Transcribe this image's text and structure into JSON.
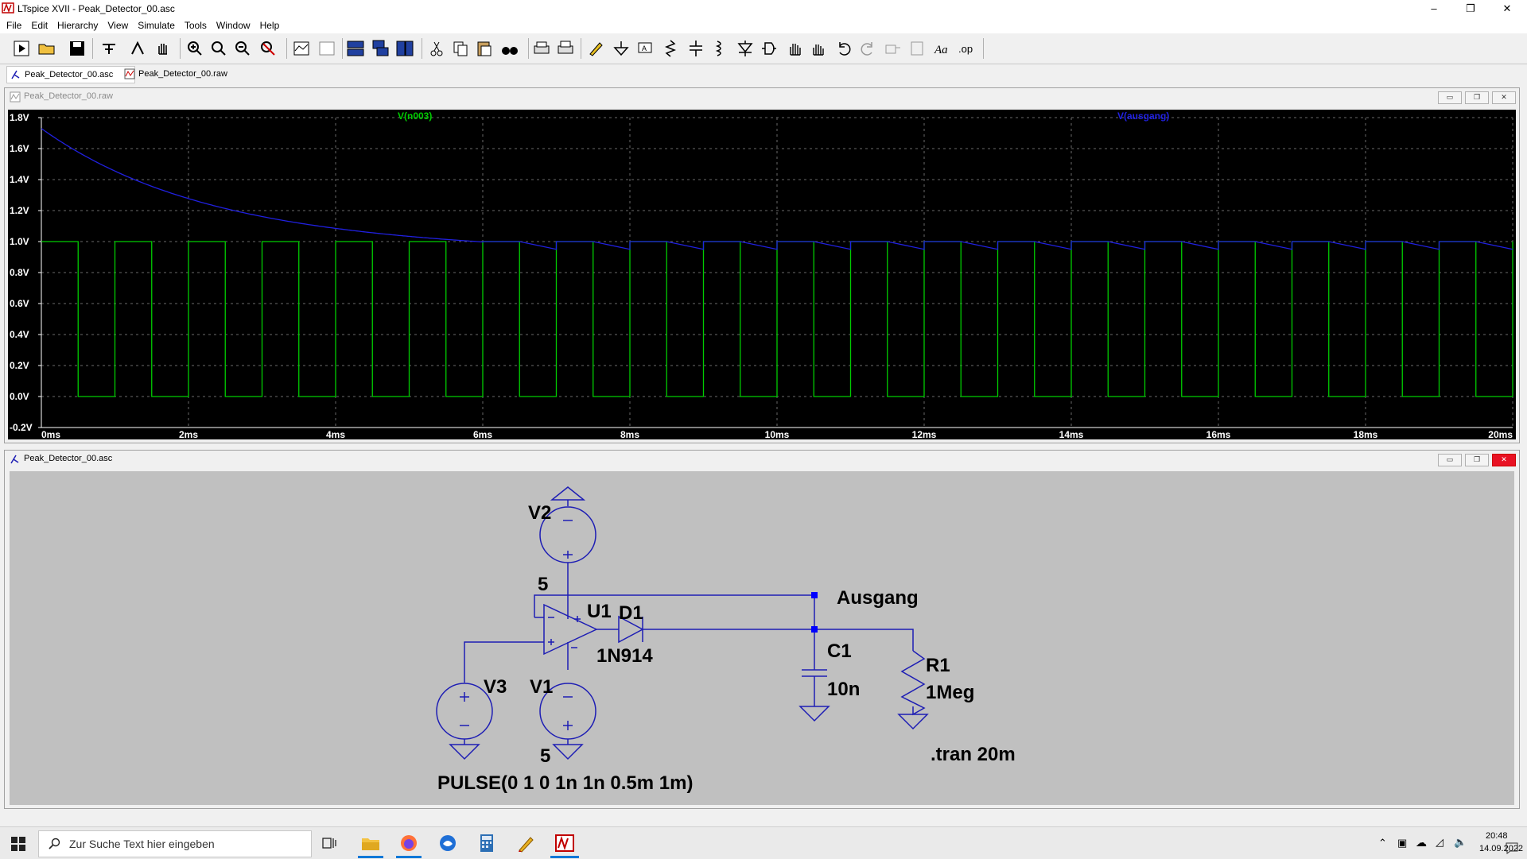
{
  "window": {
    "title": "LTspice XVII - Peak_Detector_00.asc",
    "min": "–",
    "restore": "❐",
    "close": "✕"
  },
  "menu": [
    "File",
    "Edit",
    "Hierarchy",
    "View",
    "Simulate",
    "Tools",
    "Window",
    "Help"
  ],
  "tabs": [
    {
      "label": "Peak_Detector_00.asc",
      "icon": "schematic-icon"
    },
    {
      "label": "Peak_Detector_00.raw",
      "icon": "waveform-icon"
    }
  ],
  "plot_window": {
    "title": "Peak_Detector_00.raw",
    "buttons": [
      "▭",
      "❐",
      "✕"
    ]
  },
  "schematic_window": {
    "title": "Peak_Detector_00.asc",
    "buttons": [
      "▭",
      "❐",
      "✕"
    ]
  },
  "chart_data": {
    "type": "line",
    "background": "#000000",
    "grid": true,
    "xunit": "ms",
    "xlim": [
      0,
      20
    ],
    "ylim": [
      -0.2,
      1.8
    ],
    "xticks": [
      "0ms",
      "2ms",
      "4ms",
      "6ms",
      "8ms",
      "10ms",
      "12ms",
      "14ms",
      "16ms",
      "18ms",
      "20ms"
    ],
    "yticks": [
      "1.8V",
      "1.6V",
      "1.4V",
      "1.2V",
      "1.0V",
      "0.8V",
      "0.6V",
      "0.4V",
      "0.2V",
      "0.0V",
      "-0.2V"
    ],
    "series": [
      {
        "name": "V(n003)",
        "color": "#00cc00",
        "shape": "pulse",
        "low": 0,
        "high": 1,
        "period_ms": 1,
        "width_ms": 0.5
      },
      {
        "name": "V(ausgang)",
        "color": "#2020e0",
        "shape": "peak-hold",
        "start": 1.73,
        "decay_to": 1.0,
        "decay_end_ms": 6.0,
        "ripple_low": 0.95
      }
    ]
  },
  "schematic": {
    "labels": {
      "V2": "V2",
      "V2_value": "5",
      "U1": "U1",
      "D1": "D1",
      "D1_value": "1N914",
      "C1": "C1",
      "C1_value": "10n",
      "R1": "R1",
      "R1_value": "1Meg",
      "V3": "V3",
      "V1": "V1",
      "V1_value": "5",
      "V3_value": "PULSE(0 1 0 1n 1n 0.5m 1m)",
      "net_ausgang": "Ausgang",
      "directive": ".tran 20m"
    },
    "wire_color": "#1e1eb4",
    "background": "#c0c0c0"
  },
  "taskbar": {
    "search_placeholder": "Zur Suche Text hier eingeben",
    "time": "20:48",
    "date": "14.09.2022"
  }
}
